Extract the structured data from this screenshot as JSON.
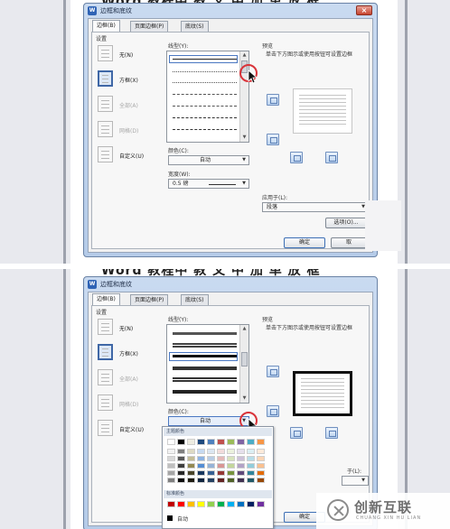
{
  "top": {
    "bg_title": "Word 教程中 教 文 中 加 单 放 框",
    "dialog_title": "边框和底纹",
    "tabs": [
      "边框(B)",
      "页面边框(P)",
      "底纹(S)"
    ],
    "settings_label": "设置",
    "settings": [
      "无(N)",
      "方框(X)",
      "全部(A)",
      "网格(D)",
      "自定义(U)"
    ],
    "line_style_label": "线型(Y):",
    "color_label": "颜色(C):",
    "color_value": "自动",
    "width_label": "宽度(W):",
    "width_value": "0.5 磅",
    "preview_label": "预览",
    "preview_hint": "单击下方图示或使用按钮可设置边框",
    "apply_to_label": "应用于(L):",
    "apply_to_value": "段落",
    "options_button": "选项(O)...",
    "ok_button": "确定",
    "cancel_button": "取"
  },
  "bottom": {
    "bg_title": "Word 教程中 教 文 中 加 单 放 框",
    "dialog_title": "边框和底纹",
    "tabs": [
      "边框(B)",
      "页面边框(P)",
      "底纹(S)"
    ],
    "settings_label": "设置",
    "settings": [
      "无(N)",
      "方框(X)",
      "全部(A)",
      "网格(D)",
      "自定义(U)"
    ],
    "line_style_label": "线型(Y):",
    "color_label": "颜色(C):",
    "color_value": "自动",
    "preview_label": "预览",
    "preview_hint": "单击下方图示或使用按钮可设置边框",
    "apply_to_label_partial": "于(L):",
    "ok_button": "确定",
    "palette": {
      "theme_header": "主题颜色",
      "standard_header": "标准颜色",
      "auto_label": "自动",
      "theme_top": [
        "#ffffff",
        "#000000",
        "#eeece1",
        "#1f497d",
        "#4f81bd",
        "#c0504d",
        "#9bbb59",
        "#8064a2",
        "#4bacc6",
        "#f79646"
      ],
      "theme_shades": [
        [
          "#f2f2f2",
          "#7f7f7f",
          "#ddd9c3",
          "#c6d9f0",
          "#dbe5f1",
          "#f2dcdb",
          "#ebf1dd",
          "#e5e0ec",
          "#dbeef3",
          "#fdeada"
        ],
        [
          "#d8d8d8",
          "#595959",
          "#c4bd97",
          "#8db3e2",
          "#b8cce4",
          "#e5b9b7",
          "#d7e3bc",
          "#ccc1d9",
          "#b7dde8",
          "#fbd5b5"
        ],
        [
          "#bfbfbf",
          "#3f3f3f",
          "#938953",
          "#548dd4",
          "#95b3d7",
          "#d99694",
          "#c3d69b",
          "#b2a2c7",
          "#92cddc",
          "#fac08f"
        ],
        [
          "#a5a5a5",
          "#262626",
          "#494429",
          "#17365d",
          "#366092",
          "#953734",
          "#76923c",
          "#5f497a",
          "#31859b",
          "#e36c09"
        ],
        [
          "#7f7f7f",
          "#0c0c0c",
          "#1d1b10",
          "#0f243e",
          "#244061",
          "#632423",
          "#4f6128",
          "#3f3151",
          "#205867",
          "#974806"
        ]
      ],
      "standard": [
        "#c00000",
        "#ff0000",
        "#ffc000",
        "#ffff00",
        "#92d050",
        "#00b050",
        "#00b0f0",
        "#0070c0",
        "#002060",
        "#7030a0"
      ]
    }
  },
  "watermark": {
    "cn": "创新互联",
    "en": "CHUANG XIN HU LIAN"
  }
}
